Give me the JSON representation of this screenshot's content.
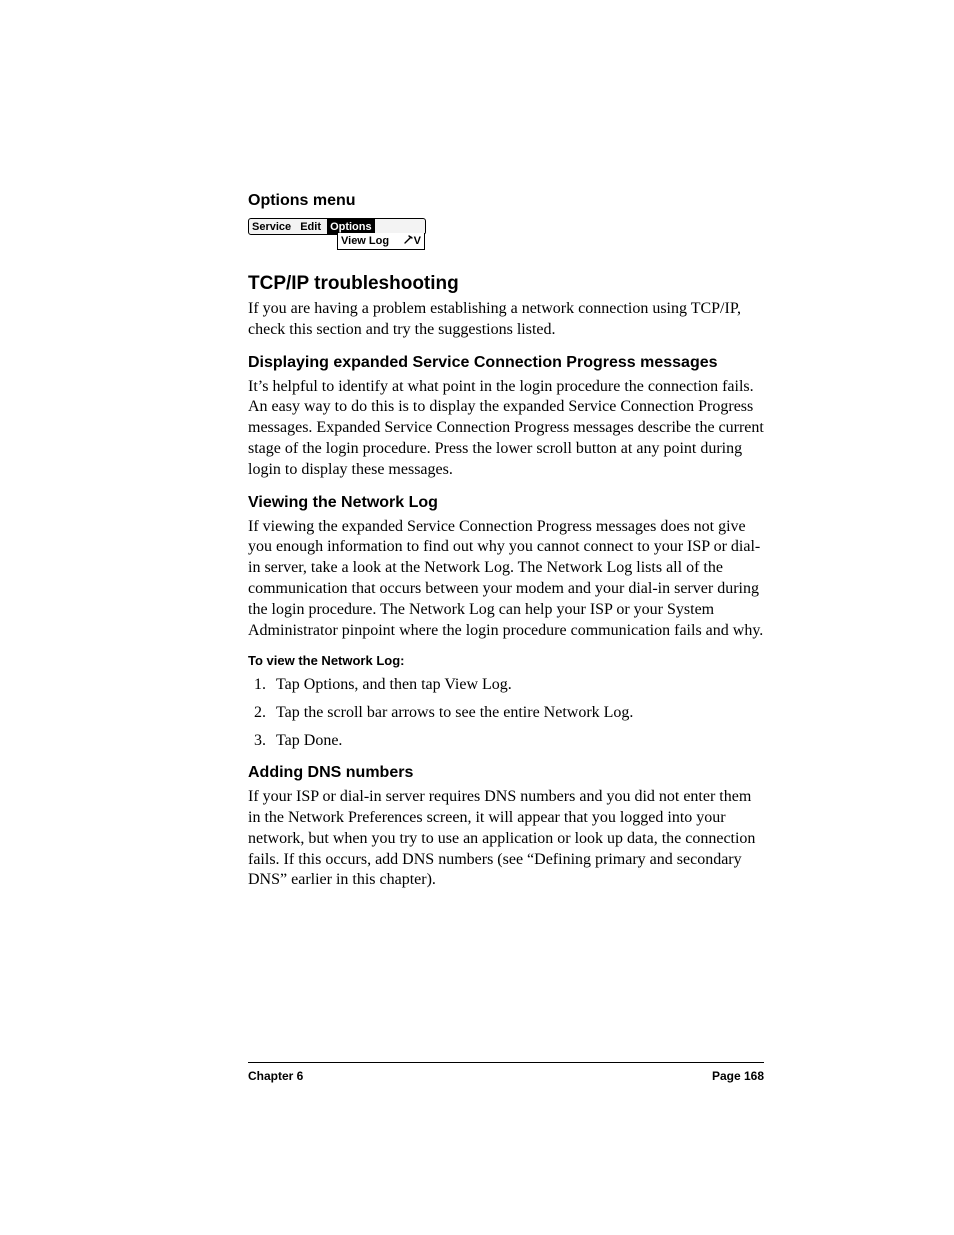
{
  "headings": {
    "options_menu": "Options menu",
    "tcpip": "TCP/IP troubleshooting",
    "displaying": "Displaying expanded Service Connection Progress messages",
    "viewing": "Viewing the Network Log",
    "to_view": "To view the Network Log:",
    "adding_dns": "Adding DNS numbers"
  },
  "menubar": {
    "items": [
      "Service",
      "Edit",
      "Options"
    ],
    "dropdown": {
      "label": "View Log",
      "shortcut": "V"
    }
  },
  "paragraphs": {
    "tcpip_intro": "If you are having a problem establishing a network connection using TCP/IP, check this section and try the suggestions listed.",
    "displaying_body": "It’s helpful to identify at what point in the login procedure the connection fails. An easy way to do this is to display the expanded Service Connection Progress messages. Expanded Service Connection Progress messages describe the current stage of the login procedure. Press the lower scroll button at any point during login to display these messages.",
    "viewing_body": "If viewing the expanded Service Connection Progress messages does not give you enough information to find out why you cannot connect to your ISP or dial-in server, take a look at the Network Log. The Network Log lists all of the communication that occurs between your modem and your dial-in server during the login procedure. The Network Log can help your ISP or your System Administrator pinpoint where the login procedure communication fails and why.",
    "adding_dns_body": "If your ISP or dial-in server requires DNS numbers and you did not enter them in the Network Preferences screen, it will appear that you logged into your network, but when you try to use an application or look up data, the connection fails. If this occurs, add DNS numbers (see “Defining primary and secondary DNS” earlier in this chapter)."
  },
  "steps": [
    "Tap Options, and then tap View Log.",
    "Tap the scroll bar arrows to see the entire Network Log.",
    "Tap Done."
  ],
  "footer": {
    "chapter": "Chapter 6",
    "page": "Page 168"
  }
}
